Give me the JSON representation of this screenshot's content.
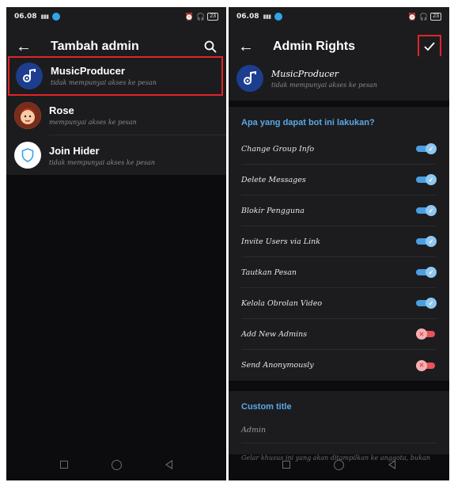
{
  "status_bar": {
    "time": "06.08",
    "signal_text": "……",
    "battery": "23"
  },
  "left": {
    "title": "Tambah admin",
    "items": [
      {
        "name": "MusicProducer",
        "subtitle": "tidak mempunyai akses ke pesan",
        "avatar": "music-note-avatar",
        "highlighted": true
      },
      {
        "name": "Rose",
        "subtitle": "mempunyai akses ke pesan",
        "avatar": "rose-avatar",
        "highlighted": false
      },
      {
        "name": "Join Hider",
        "subtitle": "tidak mempunyai akses ke pesan",
        "avatar": "shield-avatar",
        "highlighted": false
      }
    ]
  },
  "right": {
    "title": "Admin Rights",
    "bot": {
      "name": "MusicProducer",
      "subtitle": "tidak mempunyai akses ke pesan"
    },
    "section_title": "Apa yang dapat bot ini lakukan?",
    "permissions": [
      {
        "label": "Change Group Info",
        "enabled": true
      },
      {
        "label": "Delete Messages",
        "enabled": true
      },
      {
        "label": "Blokir Pengguna",
        "enabled": true
      },
      {
        "label": "Invite Users via Link",
        "enabled": true
      },
      {
        "label": "Tautkan Pesan",
        "enabled": true
      },
      {
        "label": "Kelola Obrolan Video",
        "enabled": true
      },
      {
        "label": "Add New Admins",
        "enabled": false
      },
      {
        "label": "Send Anonymously",
        "enabled": false
      }
    ],
    "custom_title": {
      "heading": "Custom title",
      "value": "Admin",
      "hint": "Gelar khusus ini yang akan ditampilkan ke anggota, bukan"
    }
  },
  "colors": {
    "accent_blue": "#5aa8e6",
    "highlight_red": "#e0242a",
    "toggle_on": "#4a9fe0",
    "toggle_off": "#e8545a"
  }
}
